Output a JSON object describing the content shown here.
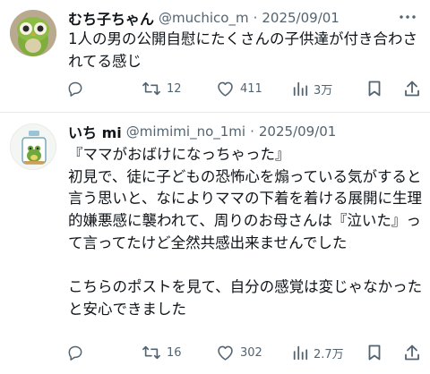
{
  "posts": [
    {
      "name": "むち子ちゃん",
      "handle": "@muchico_m",
      "date": "2025/09/01",
      "text": "1人の男の公開自慰にたくさんの子供達が付き合わされてる感じ",
      "replies": "",
      "reposts": "12",
      "likes": "411",
      "views": "3万"
    },
    {
      "name": "いち mi",
      "handle": "@mimimi_no_1mi",
      "date": "2025/09/01",
      "text": "『ママがおばけになっちゃった』\n初見で、徒に子どもの恐怖心を煽っている気がすると言う思いと、なによりママの下着を着ける展開に生理的嫌悪感に襲われて、周りのお母さんは『泣いた』って言ってたけど全然共感出来ませんでした\n\nこちらのポストを見て、自分の感覚は変じゃなかったと安心できました",
      "replies": "",
      "reposts": "16",
      "likes": "302",
      "views": "2.7万"
    }
  ],
  "separator": "·",
  "icons": [
    "reply-icon",
    "repost-icon",
    "like-icon",
    "views-icon",
    "bookmark-icon",
    "share-icon",
    "more-icon"
  ],
  "colors": {
    "text": "#0f1419",
    "muted": "#536471",
    "divider": "#e6e8ea"
  }
}
